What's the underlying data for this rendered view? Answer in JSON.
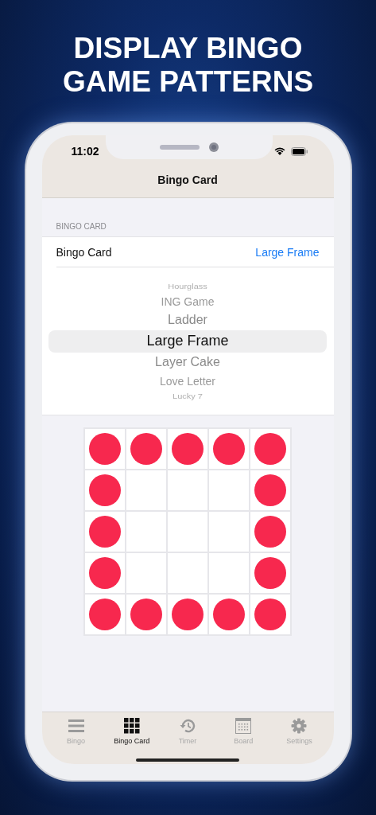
{
  "headline": [
    "DISPLAY BINGO",
    "GAME PATTERNS"
  ],
  "status_bar": {
    "time": "11:02"
  },
  "nav": {
    "title": "Bingo Card"
  },
  "section": {
    "header": "BINGO CARD",
    "row_label": "Bingo Card",
    "row_value": "Large Frame"
  },
  "picker": [
    {
      "label": "Hourglass",
      "selected": false
    },
    {
      "label": "ING Game",
      "selected": false
    },
    {
      "label": "Ladder",
      "selected": false
    },
    {
      "label": "Large Frame",
      "selected": true
    },
    {
      "label": "Layer Cake",
      "selected": false
    },
    {
      "label": "Love Letter",
      "selected": false
    },
    {
      "label": "Lucky 7",
      "selected": false
    }
  ],
  "pattern": [
    [
      true,
      true,
      true,
      true,
      true
    ],
    [
      true,
      false,
      false,
      false,
      true
    ],
    [
      true,
      false,
      false,
      false,
      true
    ],
    [
      true,
      false,
      false,
      false,
      true
    ],
    [
      true,
      true,
      true,
      true,
      true
    ]
  ],
  "tabs": [
    {
      "label": "Bingo",
      "selected": false
    },
    {
      "label": "Bingo Card",
      "selected": true
    },
    {
      "label": "Timer",
      "selected": false
    },
    {
      "label": "Board",
      "selected": false
    },
    {
      "label": "Settings",
      "selected": false
    }
  ]
}
